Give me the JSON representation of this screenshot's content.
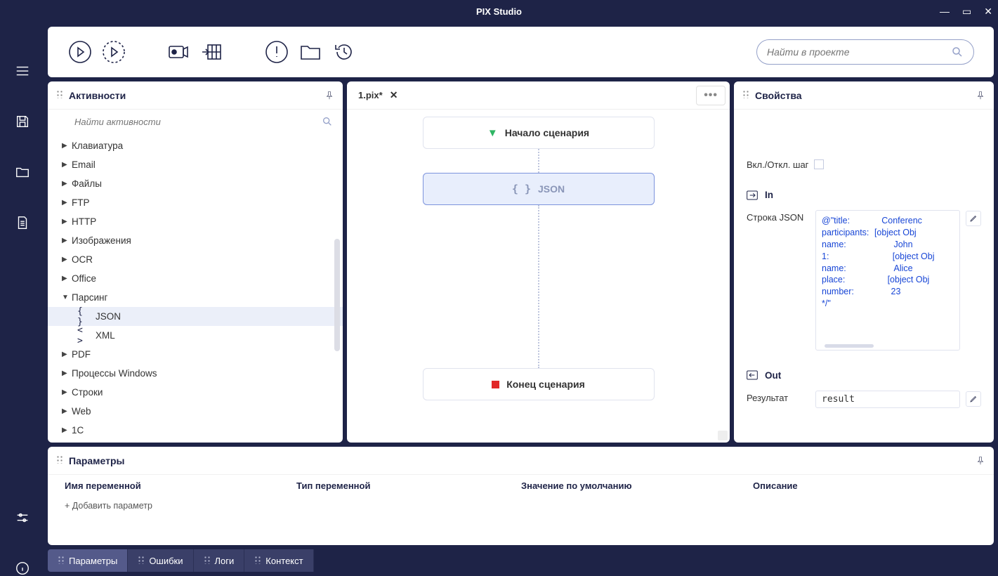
{
  "app": {
    "title": "PIX Studio"
  },
  "toolbar": {
    "search_placeholder": "Найти в проекте"
  },
  "activities": {
    "title": "Активности",
    "search_placeholder": "Найти активности",
    "items": [
      {
        "label": "Клавиатура",
        "expanded": false
      },
      {
        "label": "Email",
        "expanded": false
      },
      {
        "label": "Файлы",
        "expanded": false
      },
      {
        "label": "FTP",
        "expanded": false
      },
      {
        "label": "HTTP",
        "expanded": false
      },
      {
        "label": "Изображения",
        "expanded": false
      },
      {
        "label": "OCR",
        "expanded": false
      },
      {
        "label": "Office",
        "expanded": false
      },
      {
        "label": "Парсинг",
        "expanded": true,
        "children": [
          {
            "label": "JSON",
            "icon": "{ }",
            "selected": true
          },
          {
            "label": "XML",
            "icon": "< >",
            "selected": false
          }
        ]
      },
      {
        "label": "PDF",
        "expanded": false
      },
      {
        "label": "Процессы Windows",
        "expanded": false
      },
      {
        "label": "Строки",
        "expanded": false
      },
      {
        "label": "Web",
        "expanded": false
      },
      {
        "label": "1C",
        "expanded": false
      }
    ]
  },
  "canvas": {
    "tab_name": "1.pix*",
    "nodes": {
      "start": "Начало сценария",
      "step": "JSON",
      "end": "Конец сценария"
    }
  },
  "properties": {
    "title": "Свойства",
    "toggle_label": "Вкл./Откл. шаг",
    "in_label": "In",
    "json_label": "Строка JSON",
    "json_lines": [
      [
        "@\"title:",
        "Conferenc"
      ],
      [
        "participants:",
        "[object Obj"
      ],
      [
        "name:",
        "John"
      ],
      [
        "1:",
        "[object Obj"
      ],
      [
        "name:",
        "Alice"
      ],
      [
        "place:",
        "[object Obj"
      ],
      [
        "number:",
        "23"
      ],
      [
        "*/\"",
        ""
      ]
    ],
    "out_label": "Out",
    "result_label": "Результат",
    "result_value": "result"
  },
  "parameters": {
    "title": "Параметры",
    "cols": [
      "Имя переменной",
      "Тип переменной",
      "Значение по умолчанию",
      "Описание"
    ],
    "add_text": "+ Добавить параметр"
  },
  "footer_tabs": [
    "Параметры",
    "Ошибки",
    "Логи",
    "Контекст"
  ]
}
